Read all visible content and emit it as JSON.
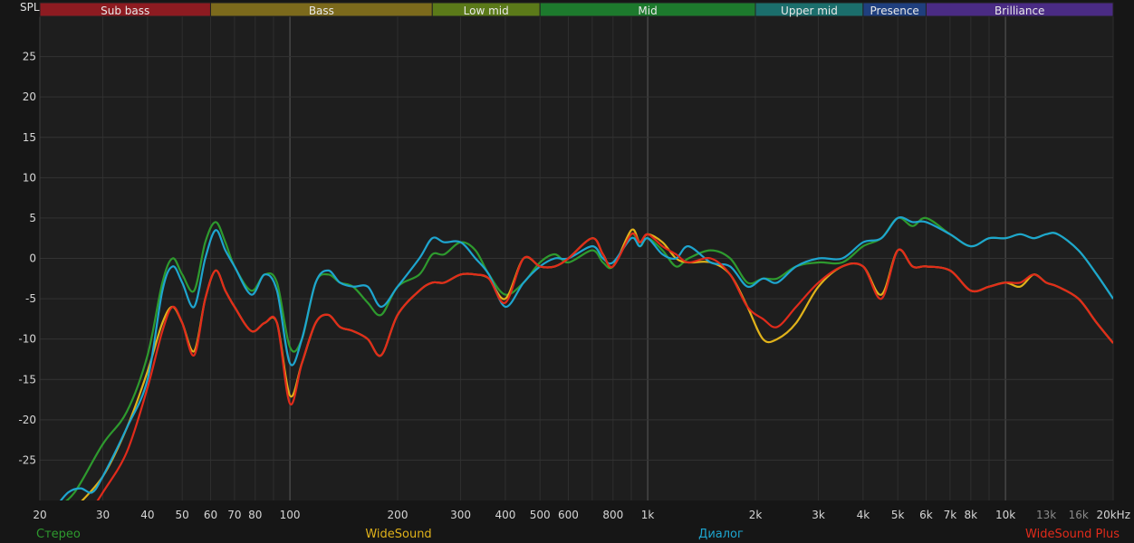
{
  "chart_data": {
    "type": "line",
    "ylabel": "SPL",
    "xunit": "Hz",
    "xscale": "log",
    "xlim": [
      20,
      20000
    ],
    "ylim": [
      -30,
      30
    ],
    "grid": true,
    "xticks": [
      {
        "v": 20,
        "label": "20"
      },
      {
        "v": 30,
        "label": "30"
      },
      {
        "v": 40,
        "label": "40"
      },
      {
        "v": 50,
        "label": "50"
      },
      {
        "v": 60,
        "label": "60"
      },
      {
        "v": 70,
        "label": "70"
      },
      {
        "v": 80,
        "label": "80"
      },
      {
        "v": 100,
        "label": "100"
      },
      {
        "v": 200,
        "label": "200"
      },
      {
        "v": 300,
        "label": "300"
      },
      {
        "v": 400,
        "label": "400"
      },
      {
        "v": 500,
        "label": "500"
      },
      {
        "v": 600,
        "label": "600"
      },
      {
        "v": 800,
        "label": "800"
      },
      {
        "v": 1000,
        "label": "1k"
      },
      {
        "v": 2000,
        "label": "2k"
      },
      {
        "v": 3000,
        "label": "3k"
      },
      {
        "v": 4000,
        "label": "4k"
      },
      {
        "v": 5000,
        "label": "5k"
      },
      {
        "v": 6000,
        "label": "6k"
      },
      {
        "v": 7000,
        "label": "7k"
      },
      {
        "v": 8000,
        "label": "8k"
      },
      {
        "v": 10000,
        "label": "10k"
      },
      {
        "v": 13000,
        "label": "13k",
        "dim": true
      },
      {
        "v": 16000,
        "label": "16k",
        "dim": true
      },
      {
        "v": 20000,
        "label": "20kHz"
      }
    ],
    "yticks": [
      25,
      20,
      15,
      10,
      5,
      0,
      -5,
      -10,
      -15,
      -20,
      -25
    ],
    "bands": [
      {
        "name": "Sub bass",
        "from": 20,
        "to": 60,
        "color": "#8d1b21"
      },
      {
        "name": "Bass",
        "from": 60,
        "to": 250,
        "color": "#7c6a1c"
      },
      {
        "name": "Low mid",
        "from": 250,
        "to": 500,
        "color": "#5b7a19"
      },
      {
        "name": "Mid",
        "from": 500,
        "to": 2000,
        "color": "#1d7a2d"
      },
      {
        "name": "Upper mid",
        "from": 2000,
        "to": 4000,
        "color": "#1b6e6c"
      },
      {
        "name": "Presence",
        "from": 4000,
        "to": 6000,
        "color": "#1f3f7e"
      },
      {
        "name": "Brilliance",
        "from": 6000,
        "to": 20000,
        "color": "#4a2b84"
      }
    ],
    "series": [
      {
        "name": "Стерео",
        "color": "#2e9a2e",
        "x": [
          22,
          25,
          30,
          35,
          40,
          44,
          47,
          50,
          54,
          58,
          62,
          66,
          70,
          78,
          85,
          92,
          100,
          108,
          118,
          128,
          138,
          150,
          165,
          180,
          200,
          230,
          250,
          270,
          300,
          330,
          360,
          400,
          450,
          500,
          550,
          600,
          700,
          750,
          800,
          900,
          950,
          1000,
          1100,
          1200,
          1300,
          1500,
          1700,
          1900,
          2100,
          2300,
          2600,
          3000,
          3500,
          4000,
          4500,
          5000,
          5500,
          6000,
          7000,
          8000,
          9000,
          10000,
          11000,
          12000,
          13000,
          14000,
          16000,
          18000,
          20000
        ],
        "y": [
          -31,
          -29,
          -23,
          -19,
          -12,
          -3,
          0,
          -2,
          -4,
          2,
          4.5,
          2,
          -1,
          -4,
          -2,
          -3,
          -11,
          -10,
          -3,
          -2,
          -3,
          -3.5,
          -5.5,
          -7,
          -3.5,
          -2,
          0.5,
          0.5,
          2,
          1,
          -2,
          -4.5,
          -3,
          -0.5,
          0.5,
          -0.5,
          1,
          -0.5,
          -1,
          3,
          1.5,
          2.5,
          1,
          -1,
          0,
          1,
          0,
          -3,
          -2.5,
          -2.5,
          -1,
          -0.5,
          -0.5,
          1.5,
          2.5,
          5,
          4,
          5,
          3,
          1.5,
          2.5,
          2.5,
          3,
          2.5,
          3,
          3,
          1,
          -2,
          -5
        ]
      },
      {
        "name": "WideSound",
        "color": "#e0b21a",
        "x": [
          25,
          30,
          35,
          40,
          44,
          47,
          50,
          54,
          58,
          62,
          66,
          70,
          78,
          85,
          92,
          100,
          108,
          118,
          128,
          138,
          150,
          165,
          180,
          200,
          230,
          250,
          270,
          300,
          330,
          360,
          400,
          450,
          500,
          550,
          600,
          700,
          750,
          800,
          900,
          950,
          1000,
          1100,
          1200,
          1300,
          1500,
          1700,
          1900,
          2100,
          2300,
          2600,
          3000,
          3500,
          4000,
          4500,
          5000,
          5500,
          6000,
          7000,
          8000,
          9000,
          10000,
          11000,
          12000,
          13000,
          14000,
          16000,
          18000,
          20000
        ],
        "y": [
          -31,
          -27,
          -21,
          -14,
          -8,
          -6,
          -8,
          -11.5,
          -5,
          -1.5,
          -4,
          -6,
          -9,
          -8,
          -8,
          -17,
          -13,
          -8,
          -7,
          -8.5,
          -9,
          -10,
          -12,
          -7,
          -4,
          -3,
          -3,
          -2,
          -2,
          -2.5,
          -5,
          0,
          -1,
          -1,
          0,
          2.5,
          0.5,
          -1,
          3.5,
          2,
          3,
          2,
          0,
          -0.5,
          -0.5,
          -2,
          -6,
          -10,
          -10,
          -8,
          -3.5,
          -1,
          -1,
          -4.5,
          1,
          -1,
          -1,
          -1.5,
          -4,
          -3.5,
          -3,
          -3.5,
          -2,
          -3,
          -3.5,
          -5,
          -8,
          -10.5
        ]
      },
      {
        "name": "Диалог",
        "color": "#1ea5cf",
        "x": [
          22,
          24,
          26,
          28,
          30,
          35,
          40,
          44,
          47,
          50,
          54,
          58,
          62,
          66,
          70,
          78,
          85,
          92,
          100,
          108,
          118,
          128,
          138,
          150,
          165,
          180,
          200,
          230,
          250,
          270,
          300,
          330,
          360,
          400,
          450,
          500,
          550,
          600,
          700,
          750,
          800,
          900,
          950,
          1000,
          1100,
          1200,
          1300,
          1500,
          1700,
          1900,
          2100,
          2300,
          2600,
          3000,
          3500,
          4000,
          4500,
          5000,
          5500,
          6000,
          7000,
          8000,
          9000,
          10000,
          11000,
          12000,
          13000,
          14000,
          16000,
          18000,
          20000
        ],
        "y": [
          -31,
          -29,
          -28.5,
          -29,
          -27,
          -21,
          -15,
          -4,
          -1,
          -3,
          -6,
          0,
          3.5,
          1,
          -1,
          -4.5,
          -2,
          -4,
          -13,
          -10,
          -3,
          -1.5,
          -3,
          -3.5,
          -3.5,
          -6,
          -3.5,
          0,
          2.5,
          2,
          2,
          0,
          -2,
          -6,
          -3,
          -1,
          0,
          0,
          1.5,
          0,
          -0.5,
          2.5,
          1.5,
          2.5,
          0.5,
          0,
          1.5,
          -0.5,
          -1,
          -3.5,
          -2.5,
          -3,
          -1,
          0,
          0,
          2,
          2.5,
          5,
          4.5,
          4.5,
          3,
          1.5,
          2.5,
          2.5,
          3,
          2.5,
          3,
          3,
          1,
          -2,
          -5
        ]
      },
      {
        "name": "WideSound Plus",
        "color": "#e12b1b",
        "x": [
          28,
          30,
          35,
          40,
          44,
          47,
          50,
          54,
          58,
          62,
          66,
          70,
          78,
          85,
          92,
          100,
          108,
          118,
          128,
          138,
          150,
          165,
          180,
          200,
          230,
          250,
          270,
          300,
          330,
          360,
          400,
          450,
          500,
          550,
          600,
          700,
          750,
          800,
          900,
          950,
          1000,
          1100,
          1200,
          1300,
          1500,
          1700,
          1900,
          2100,
          2300,
          2600,
          3000,
          3500,
          4000,
          4500,
          5000,
          5500,
          6000,
          7000,
          8000,
          9000,
          10000,
          11000,
          12000,
          13000,
          14000,
          16000,
          18000,
          20000
        ],
        "y": [
          -31,
          -29,
          -24,
          -16,
          -9,
          -6,
          -8,
          -12,
          -5,
          -1.5,
          -4,
          -6,
          -9,
          -8,
          -8,
          -18,
          -13,
          -8,
          -7,
          -8.5,
          -9,
          -10,
          -12,
          -7,
          -4,
          -3,
          -3,
          -2,
          -2,
          -2.5,
          -5.5,
          0,
          -1,
          -1,
          0,
          2.5,
          0.5,
          -1,
          3,
          2,
          3,
          1.5,
          0.5,
          -0.5,
          0,
          -2,
          -6,
          -7.5,
          -8.5,
          -6,
          -3,
          -1,
          -1,
          -5,
          1,
          -1,
          -1,
          -1.5,
          -4,
          -3.5,
          -3,
          -3,
          -2,
          -3,
          -3.5,
          -5,
          -8,
          -10.5
        ]
      }
    ]
  }
}
